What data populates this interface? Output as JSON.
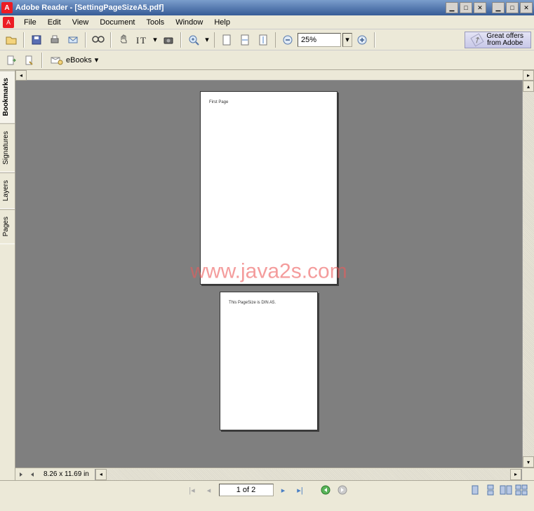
{
  "title": "Adobe Reader - [SettingPageSizeA5.pdf]",
  "menu": {
    "file": "File",
    "edit": "Edit",
    "view": "View",
    "document": "Document",
    "tools": "Tools",
    "window": "Window",
    "help": "Help"
  },
  "toolbar": {
    "zoom_value": "25%",
    "offers_line1": "Great offers",
    "offers_line2": "from Adobe"
  },
  "toolbar2": {
    "ebooks": "eBooks"
  },
  "side_tabs": {
    "bookmarks": "Bookmarks",
    "signatures": "Signatures",
    "layers": "Layers",
    "pages": "Pages"
  },
  "pages": {
    "p1_text": "First Page",
    "p2_text": "This PageSize is DIN A5."
  },
  "status": {
    "dimensions": "8.26 x 11.69 in",
    "page_display": "1 of 2"
  },
  "watermark": "www.java2s.com",
  "icons": {
    "app_letter": "A"
  }
}
